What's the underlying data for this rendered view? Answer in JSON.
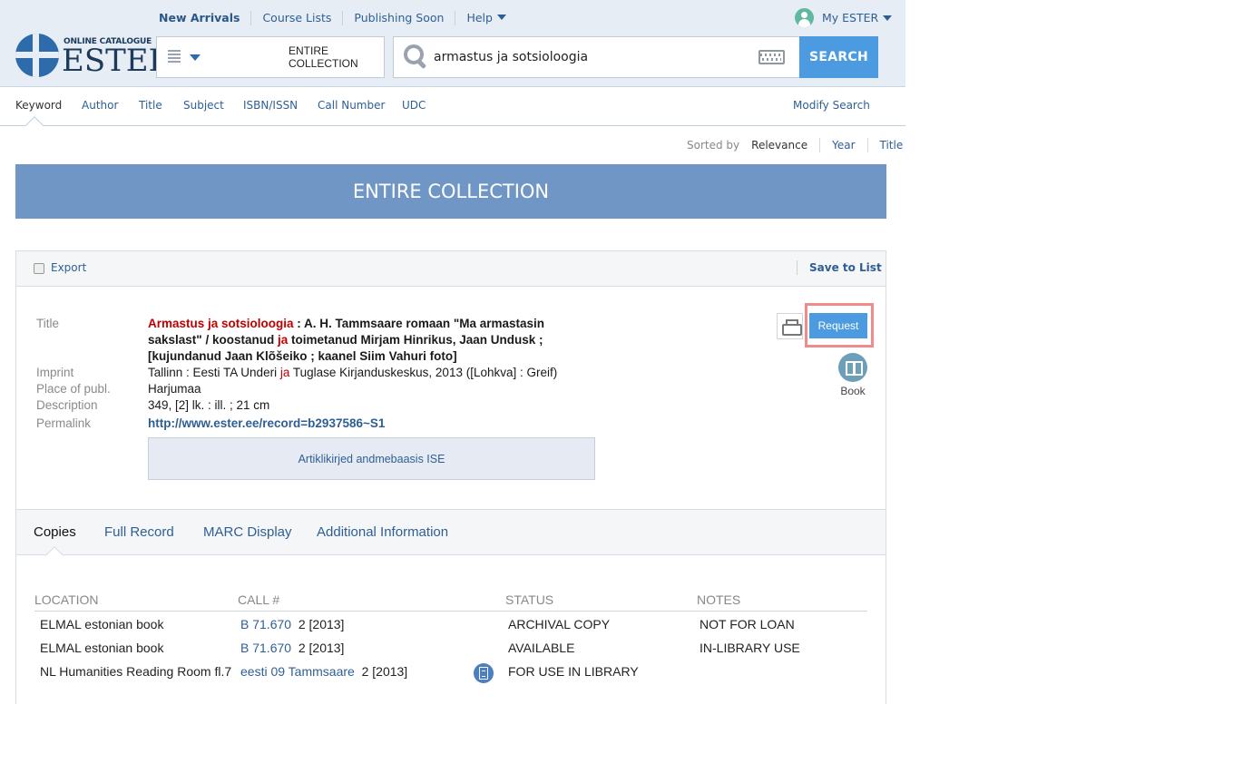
{
  "topnav": {
    "new_arrivals": "New Arrivals",
    "course_lists": "Course Lists",
    "publishing_soon": "Publishing Soon",
    "help": "Help"
  },
  "account": {
    "label": "My ESTER"
  },
  "logo": {
    "small": "ONLINE CATALOGUE",
    "big": "ESTER"
  },
  "search": {
    "scope": "ENTIRE COLLECTION",
    "query": "armastus ja sotsioloogia",
    "button": "SEARCH"
  },
  "search_tabs": {
    "keyword": "Keyword",
    "author": "Author",
    "title": "Title",
    "subject": "Subject",
    "isbn": "ISBN/ISSN",
    "call_number": "Call Number",
    "udc": "UDC",
    "modify": "Modify Search"
  },
  "sort": {
    "label": "Sorted by",
    "relevance": "Relevance",
    "year": "Year",
    "title": "Title"
  },
  "banner": "ENTIRE COLLECTION",
  "toolbar": {
    "export": "Export",
    "save": "Save to List"
  },
  "record": {
    "labels": {
      "title": "Title",
      "imprint": "Imprint",
      "place": "Place of publ.",
      "description": "Description",
      "permalink": "Permalink"
    },
    "title_hl_1": "Armastus ja sotsioloogia",
    "title_part_1": " : A. H. Tammsaare romaan \"Ma armastasin sakslast\" / koostanud ",
    "title_hl_2": "ja",
    "title_part_2": " toimetanud Mirjam Hinrikus, Jaan Undusk ; [kujundanud Jaan Klõšeiko ; kaanel Siim Vahuri foto]",
    "imprint_part_1": "Tallinn : Eesti TA Underi ",
    "imprint_hl": "ja",
    "imprint_part_2": " Tuglase Kirjanduskeskus, 2013 ([Lohkva] : Greif)",
    "place": "Harjumaa",
    "description": "349, [2] lk. : ill. ; 21 cm",
    "permalink": "http://www.ester.ee/record=b2937586~S1",
    "ise_link": "Artiklikirjed andmebaasis ISE",
    "request": "Request",
    "type": "Book"
  },
  "detail_tabs": {
    "copies": "Copies",
    "full_record": "Full Record",
    "marc": "MARC Display",
    "additional": "Additional Information"
  },
  "copies": {
    "headers": {
      "location": "LOCATION",
      "call": "CALL #",
      "status": "STATUS",
      "notes": "NOTES"
    },
    "rows": [
      {
        "location": "ELMAL estonian book",
        "call_link": "B 71.670",
        "call_rest": "2 [2013]",
        "status": "ARCHIVAL COPY",
        "notes": "NOT FOR LOAN"
      },
      {
        "location": "ELMAL estonian book",
        "call_link": "B 71.670",
        "call_rest": "2 [2013]",
        "status": "AVAILABLE",
        "notes": "IN-LIBRARY USE"
      },
      {
        "location": "NL Humanities Reading Room fl.7",
        "call_link": "eesti 09 Tammsaare",
        "call_rest": "2 [2013]",
        "status": "FOR USE IN LIBRARY",
        "notes": ""
      }
    ]
  }
}
